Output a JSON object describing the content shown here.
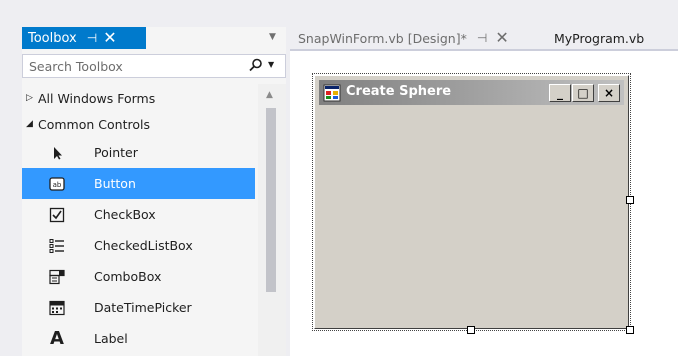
{
  "toolbox": {
    "title": "Toolbox",
    "pin_glyph": "⊣",
    "close_glyph": "✕",
    "search_placeholder": "Search Toolbox",
    "groups": [
      {
        "label": "All Windows Forms",
        "expanded": false
      },
      {
        "label": "Common Controls",
        "expanded": true
      }
    ],
    "items": [
      {
        "label": "Pointer",
        "icon": "pointer-icon"
      },
      {
        "label": "Button",
        "icon": "button-icon",
        "selected": true
      },
      {
        "label": "CheckBox",
        "icon": "checkbox-icon"
      },
      {
        "label": "CheckedListBox",
        "icon": "checkedlistbox-icon"
      },
      {
        "label": "ComboBox",
        "icon": "combobox-icon"
      },
      {
        "label": "DateTimePicker",
        "icon": "datetimepicker-icon"
      },
      {
        "label": "Label",
        "icon": "label-icon"
      }
    ]
  },
  "tabs": {
    "designer": "SnapWinForm.vb [Design]*",
    "program": "MyProgram.vb"
  },
  "form": {
    "title": "Create Sphere",
    "minimize": "_",
    "maximize": "□",
    "close": "×"
  },
  "colors": {
    "accent": "#007acc",
    "selection": "#3399ff",
    "form_face": "#d4d0c8"
  }
}
